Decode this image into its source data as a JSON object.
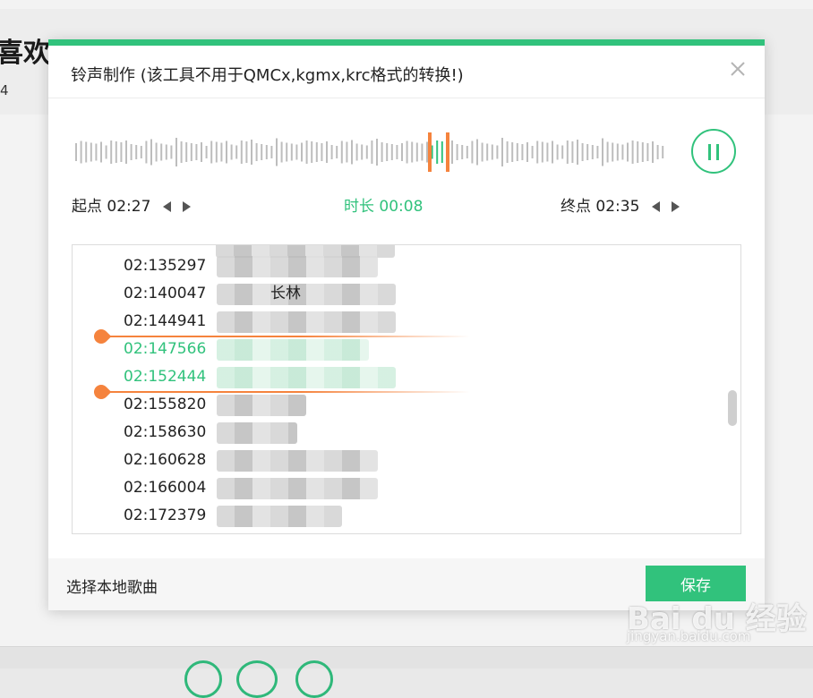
{
  "background": {
    "title": "喜欢",
    "subtitle": "4"
  },
  "dialog": {
    "title": "铃声制作 (该工具不用于QMCx,kgmx,krc格式的转换!)",
    "close_icon": "close-icon",
    "accent_color": "#31c27c",
    "marker_color": "#f5833d"
  },
  "player": {
    "pause_icon": "pause-icon"
  },
  "times": {
    "start_label": "起点",
    "start_value": "02:27",
    "duration_label": "时长",
    "duration_value": "00:08",
    "end_label": "终点",
    "end_value": "02:35"
  },
  "lyrics": [
    {
      "time": "02:135297",
      "text": "",
      "active": false
    },
    {
      "time": "02:140047",
      "text": "长林",
      "active": false
    },
    {
      "time": "02:144941",
      "text": "",
      "active": false
    },
    {
      "time": "02:147566",
      "text": "",
      "active": true
    },
    {
      "time": "02:152444",
      "text": "",
      "active": true
    },
    {
      "time": "02:155820",
      "text": "",
      "active": false
    },
    {
      "time": "02:158630",
      "text": "",
      "active": false
    },
    {
      "time": "02:160628",
      "text": "",
      "active": false
    },
    {
      "time": "02:166004",
      "text": "",
      "active": false
    },
    {
      "time": "02:172379",
      "text": "",
      "active": false
    }
  ],
  "footer": {
    "local_song_label": "选择本地歌曲",
    "save_label": "保存"
  },
  "watermark": {
    "brand": "Bai du 经验",
    "url": "jingyan.baidu.com"
  }
}
